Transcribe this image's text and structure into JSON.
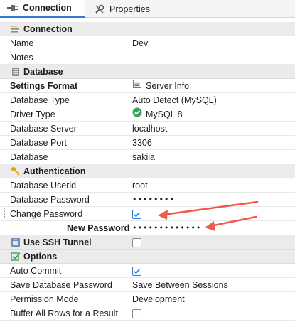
{
  "tabs": [
    {
      "label": "Connection",
      "icon": "plug-icon",
      "active": true
    },
    {
      "label": "Properties",
      "icon": "wrench-icon",
      "active": false
    }
  ],
  "sections": {
    "connection": {
      "title": "Connection",
      "rows": [
        {
          "label": "Name",
          "value": "Dev"
        },
        {
          "label": "Notes",
          "value": ""
        }
      ]
    },
    "database": {
      "title": "Database",
      "settings_format": {
        "label": "Settings Format",
        "value": "Server Info"
      },
      "rows": [
        {
          "label": "Database Type",
          "value": "Auto Detect (MySQL)"
        },
        {
          "label": "Driver Type",
          "value": "MySQL 8"
        },
        {
          "label": "Database Server",
          "value": "localhost"
        },
        {
          "label": "Database Port",
          "value": "3306"
        },
        {
          "label": "Database",
          "value": "sakila"
        }
      ]
    },
    "authentication": {
      "title": "Authentication",
      "userid": {
        "label": "Database Userid",
        "value": "root"
      },
      "password": {
        "label": "Database Password",
        "value": "••••••••"
      },
      "change_password": {
        "label": "Change Password",
        "checked": true
      },
      "new_password": {
        "label": "New Password",
        "value": "•••••••••••••"
      }
    },
    "ssh": {
      "title": "Use SSH Tunnel",
      "checked": false
    },
    "options": {
      "title": "Options",
      "auto_commit": {
        "label": "Auto Commit",
        "checked": true
      },
      "save_password": {
        "label": "Save Database Password",
        "value": "Save Between Sessions"
      },
      "permission_mode": {
        "label": "Permission Mode",
        "value": "Development"
      },
      "buffer_rows": {
        "label": "Buffer All Rows for a Result",
        "checked": false
      }
    }
  },
  "colors": {
    "accent": "#2f7bd6",
    "arrow": "#f05a4a",
    "section_bg": "#ebebeb",
    "check_green": "#3aa55a"
  }
}
